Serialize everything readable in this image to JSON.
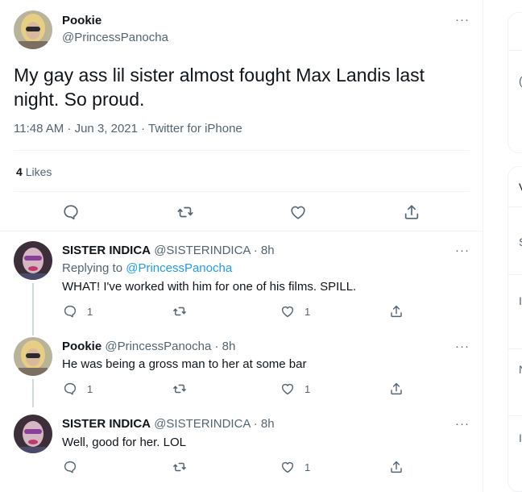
{
  "main_tweet": {
    "name": "Pookie",
    "handle": "@PrincessPanocha",
    "text": "My gay ass lil sister almost fought Max Landis last night. So proud.",
    "meta": "11:48 AM · Jun 3, 2021 · Twitter for iPhone",
    "likes_count": "4",
    "likes_label": "Likes",
    "more": "···"
  },
  "replies": [
    {
      "name": "SISTER INDICA",
      "handle": "@SISTERINDICA · 8h",
      "replying_prefix": "Replying to",
      "replying_to": "@PrincessPanocha",
      "text": "WHAT! I've worked with him for one of his films. SPILL.",
      "reply_count": "1",
      "retweet_count": "",
      "like_count": "1",
      "more": "···"
    },
    {
      "name": "Pookie",
      "handle": "@PrincessPanocha · 8h",
      "text": "He was being a gross man to her at some bar",
      "reply_count": "1",
      "retweet_count": "",
      "like_count": "1",
      "more": "···"
    },
    {
      "name": "SISTER INDICA",
      "handle": "@SISTERINDICA · 8h",
      "text": "Well, good for her. LOL",
      "reply_count": "",
      "retweet_count": "",
      "like_count": "1",
      "more": "···"
    }
  ],
  "right_fragments": [
    "(",
    "V",
    "S",
    "I",
    "N",
    "I",
    "I",
    "S",
    "C"
  ],
  "colors": {
    "text": "#0f1419",
    "secondary": "#536471",
    "link": "#1d9bf0",
    "border": "#eff3f4",
    "thread_line": "#cfd9de"
  },
  "icons": [
    "reply-icon",
    "retweet-icon",
    "like-icon",
    "share-icon",
    "more-icon"
  ]
}
